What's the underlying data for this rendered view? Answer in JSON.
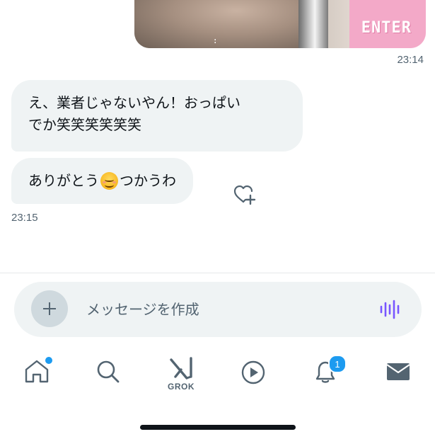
{
  "conversation": {
    "media": {
      "overlay_text": "ENTER"
    },
    "media_timestamp": "23:14",
    "messages": [
      {
        "lines": [
          "え、業者じゃないやん！おっぱい",
          "でか笑笑笑笑笑笑"
        ]
      },
      {
        "text_before": "ありがとう",
        "emoji": "smiling-face-emoji",
        "text_after": "つかうわ"
      }
    ],
    "last_timestamp": "23:15"
  },
  "composer": {
    "placeholder": "メッセージを作成"
  },
  "tabbar": {
    "grok_label": "GROK",
    "notifications_badge": "1"
  },
  "colors": {
    "accent": "#1d9bf0",
    "bubble": "#eff3f4",
    "voice_icon": "#7856ff"
  }
}
